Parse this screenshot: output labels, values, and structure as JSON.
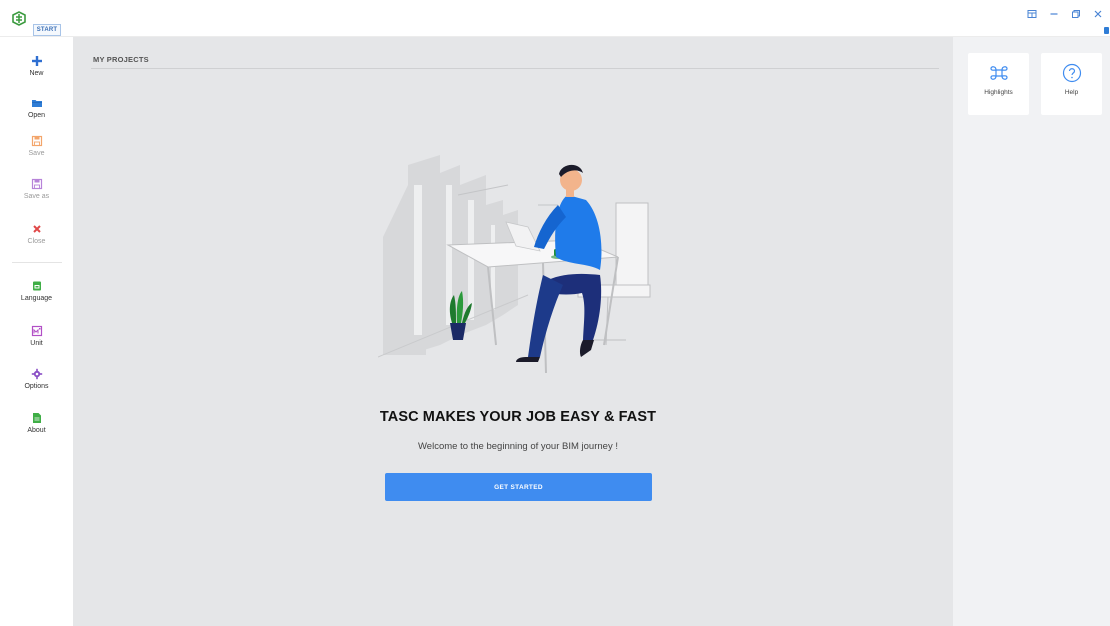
{
  "titlebar": {
    "tab_label": "START"
  },
  "sidebar": {
    "items": [
      {
        "label": "New",
        "icon": "plus-icon",
        "color": "#2f6fd1"
      },
      {
        "label": "Open",
        "icon": "folder-icon",
        "color": "#2f7dd6"
      },
      {
        "label": "Save",
        "icon": "save-icon",
        "color": "#f3a56b"
      },
      {
        "label": "Save as",
        "icon": "save-as-icon",
        "color": "#b783d9"
      },
      {
        "label": "Close",
        "icon": "close-icon",
        "color": "#e04848"
      },
      {
        "label": "Language",
        "icon": "language-icon",
        "color": "#3fae46"
      },
      {
        "label": "Unit",
        "icon": "unit-icon",
        "color": "#b24fc6"
      },
      {
        "label": "Options",
        "icon": "gear-icon",
        "color": "#8a4fc6"
      },
      {
        "label": "About",
        "icon": "document-icon",
        "color": "#3fae46"
      }
    ]
  },
  "main": {
    "section_title": "MY PROJECTS",
    "headline": "TASC MAKES YOUR JOB EASY & FAST",
    "welcome": "Welcome to the beginning of  your BIM journey !",
    "cta_label": "GET STARTED"
  },
  "right_panel": {
    "cards": [
      {
        "label": "Highlights",
        "icon": "command-icon"
      },
      {
        "label": "Help",
        "icon": "help-icon"
      }
    ]
  },
  "colors": {
    "accent": "#3f8cf0",
    "main_bg": "#e5e6e8",
    "panel_bg": "#f1f2f4"
  }
}
